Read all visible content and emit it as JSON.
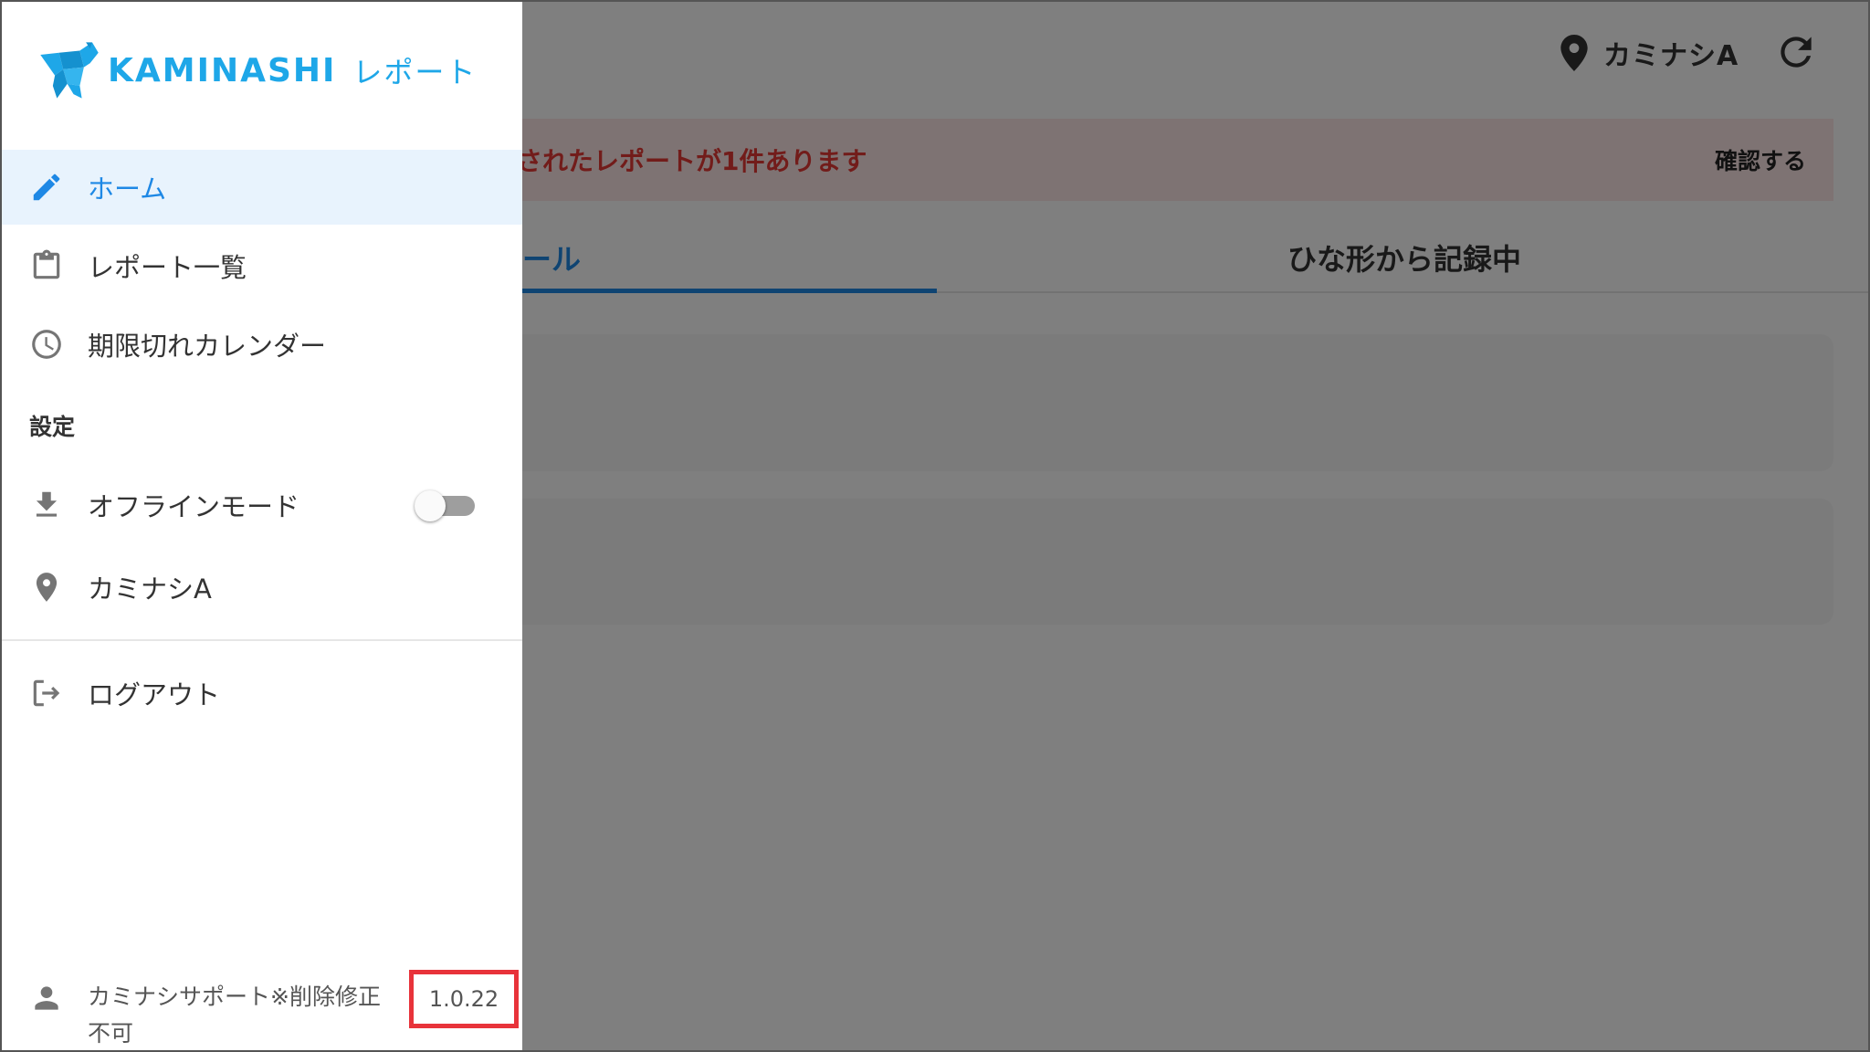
{
  "header": {
    "location": "カミナシA",
    "icons": {
      "location": "map-pin-icon",
      "refresh": "refresh-icon"
    }
  },
  "alert": {
    "message": "されたレポートが1件あります",
    "action_label": "確認する"
  },
  "tabs": [
    {
      "label": "ール",
      "active": true
    },
    {
      "label": "ひな形から記録中",
      "active": false
    }
  ],
  "drawer": {
    "logo": {
      "brand": "KAMINASHI",
      "product": "レポート"
    },
    "nav": [
      {
        "label": "ホーム",
        "icon": "pencil-icon",
        "active": true
      },
      {
        "label": "レポート一覧",
        "icon": "clipboard-icon"
      },
      {
        "label": "期限切れカレンダー",
        "icon": "clock-icon"
      }
    ],
    "settings_title": "設定",
    "offline": {
      "label": "オフラインモード",
      "icon": "download-icon",
      "enabled": false
    },
    "location": {
      "label": "カミナシA",
      "icon": "map-pin-icon"
    },
    "logout": {
      "label": "ログアウト",
      "icon": "logout-icon"
    },
    "user": {
      "name": "カミナシサポート※削除修正不可",
      "icon": "person-icon"
    },
    "version": "1.0.22"
  },
  "colors": {
    "accent": "#1e88e5",
    "logo": "#1ea7e8",
    "alert_text": "#e53935",
    "alert_bg": "#fde7e7",
    "highlight_box": "#e8333a"
  }
}
